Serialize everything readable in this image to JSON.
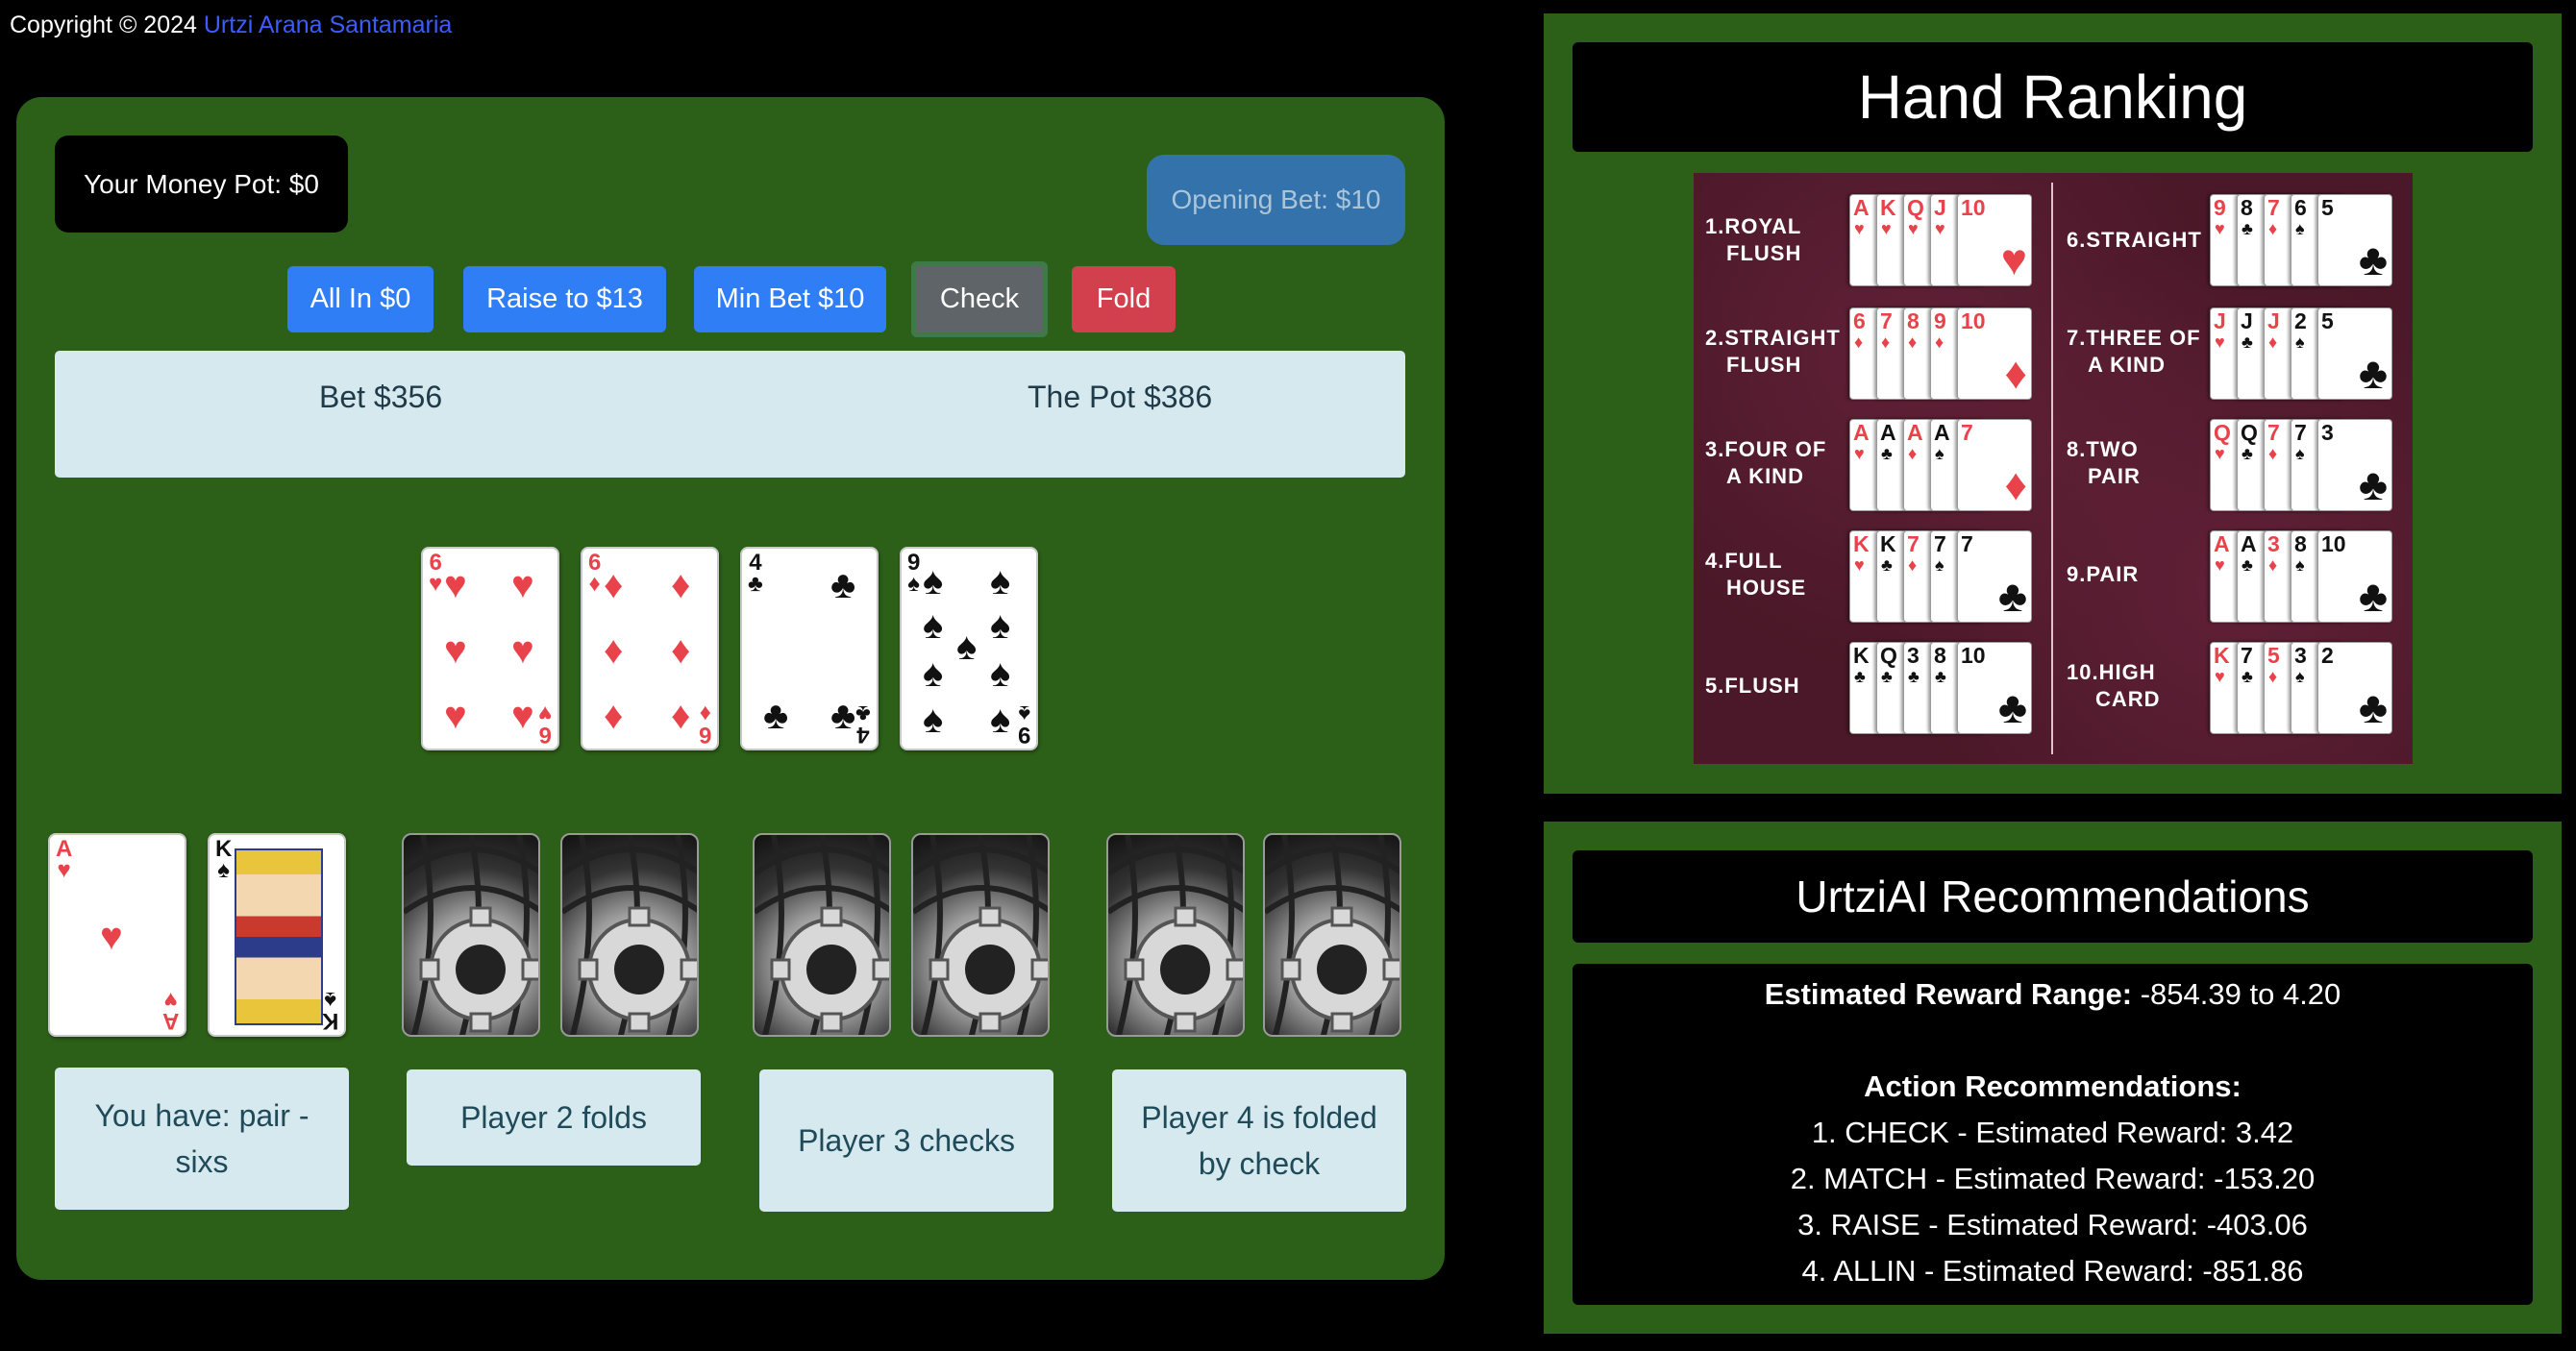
{
  "copyright": {
    "prefix": "Copyright © 2024 ",
    "author": "Urtzi Arana Santamaria"
  },
  "table": {
    "money_pot": "Your Money Pot: $0",
    "opening_bet": "Opening Bet: $10",
    "buttons": {
      "all_in": "All In $0",
      "raise": "Raise to $13",
      "min_bet": "Min Bet $10",
      "check": "Check",
      "fold": "Fold"
    },
    "bet": "Bet $356",
    "pot": "The Pot $386",
    "community_cards": [
      {
        "rank": "6",
        "suit": "♥",
        "color": "red"
      },
      {
        "rank": "6",
        "suit": "♦",
        "color": "red"
      },
      {
        "rank": "4",
        "suit": "♣",
        "color": "black"
      },
      {
        "rank": "9",
        "suit": "♠",
        "color": "black"
      }
    ],
    "player_cards": [
      {
        "rank": "A",
        "suit": "♥",
        "color": "red"
      },
      {
        "rank": "K",
        "suit": "♠",
        "color": "black"
      }
    ],
    "statuses": {
      "player1": "You have: pair - sixs",
      "player2": "Player 2 folds",
      "player3": "Player 3 checks",
      "player4": "Player 4 is folded by check"
    }
  },
  "hand_ranking": {
    "title": "Hand Ranking",
    "left": [
      {
        "num": "1.",
        "name1": "ROYAL",
        "name2": "FLUSH"
      },
      {
        "num": "2.",
        "name1": "STRAIGHT",
        "name2": "FLUSH"
      },
      {
        "num": "3.",
        "name1": "FOUR OF",
        "name2": "A KIND"
      },
      {
        "num": "4.",
        "name1": "FULL",
        "name2": "HOUSE"
      },
      {
        "num": "5.",
        "name1": "FLUSH",
        "name2": ""
      }
    ],
    "right": [
      {
        "num": "6.",
        "name1": "STRAIGHT",
        "name2": ""
      },
      {
        "num": "7.",
        "name1": "THREE OF",
        "name2": "A KIND"
      },
      {
        "num": "8.",
        "name1": "TWO",
        "name2": "PAIR"
      },
      {
        "num": "9.",
        "name1": "PAIR",
        "name2": ""
      },
      {
        "num": "10.",
        "name1": "HIGH",
        "name2": "CARD"
      }
    ]
  },
  "ai": {
    "title": "UrtziAI Recommendations",
    "reward_label": "Estimated Reward Range:",
    "reward_value": " -854.39 to 4.20",
    "actions_title": "Action Recommendations:",
    "actions": [
      "1. CHECK - Estimated Reward: 3.42",
      "2. MATCH - Estimated Reward: -153.20",
      "3. RAISE - Estimated Reward: -403.06",
      "4. ALLIN - Estimated Reward: -851.86"
    ]
  },
  "colors": {
    "felt": "#2c5f18",
    "button_blue": "#2f7ef6",
    "button_fold": "#d23f4d",
    "info_box": "#d6e9ee"
  }
}
